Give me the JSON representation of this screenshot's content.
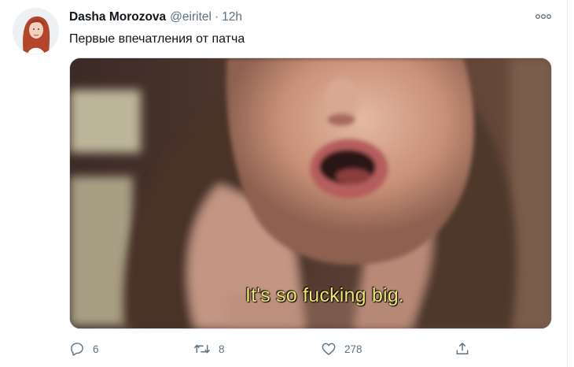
{
  "tweet": {
    "display_name": "Dasha Morozova",
    "handle": "@eiritel",
    "separator": "·",
    "time": "12h",
    "text": "Первые впечатления от патча",
    "more_icon": "more-horizontal-icon",
    "media": {
      "caption": "It's so fucking big."
    },
    "actions": {
      "reply": {
        "icon": "reply-icon",
        "count": "6"
      },
      "retweet": {
        "icon": "retweet-icon",
        "count": "8"
      },
      "like": {
        "icon": "heart-icon",
        "count": "278"
      },
      "share": {
        "icon": "share-icon",
        "count": ""
      }
    },
    "colors": {
      "text": "#0f1419",
      "secondary": "#5b7083",
      "caption": "#f0e76b"
    }
  }
}
